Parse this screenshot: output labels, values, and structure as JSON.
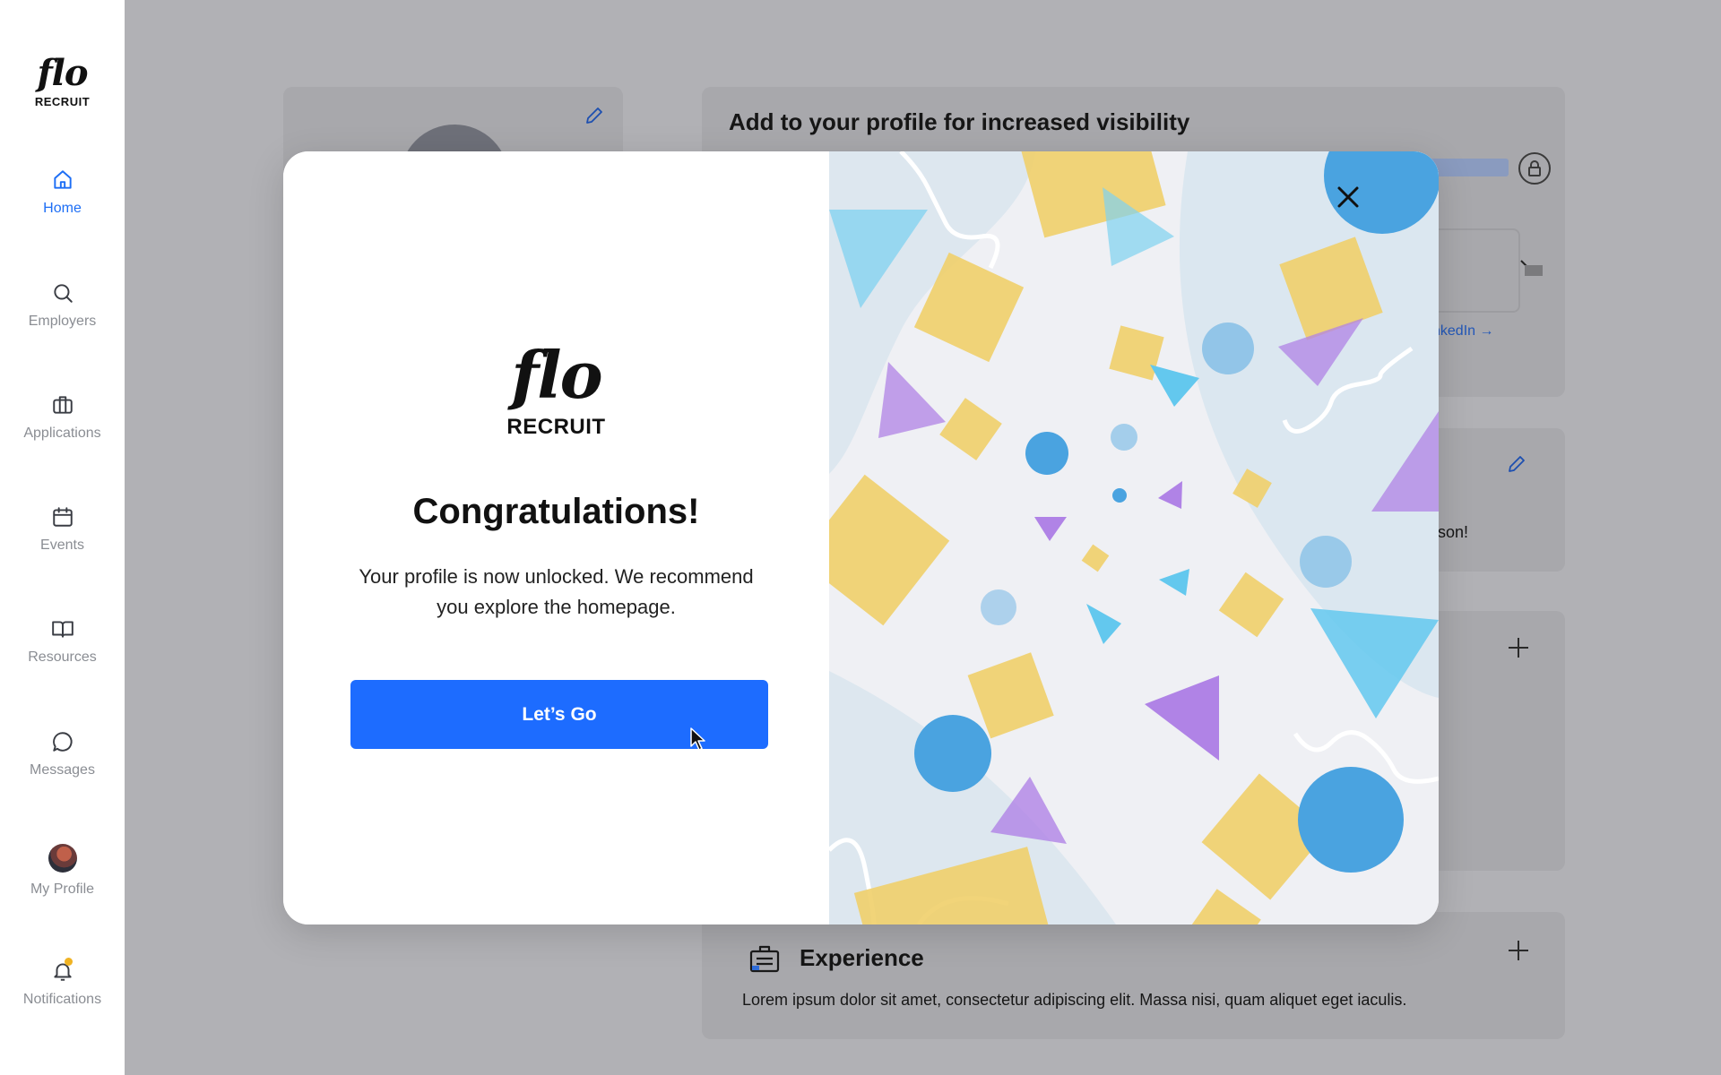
{
  "app": {
    "logo_script": "flo",
    "logo_word": "RECRUIT"
  },
  "sidebar": {
    "items": [
      {
        "label": "Home",
        "icon": "home-icon",
        "active": true
      },
      {
        "label": "Employers",
        "icon": "search-icon"
      },
      {
        "label": "Applications",
        "icon": "briefcase-icon"
      },
      {
        "label": "Events",
        "icon": "calendar-icon"
      },
      {
        "label": "Resources",
        "icon": "book-icon"
      },
      {
        "label": "Messages",
        "icon": "message-icon"
      },
      {
        "label": "My Profile",
        "icon": "avatar"
      },
      {
        "label": "Notifications",
        "icon": "bell-icon"
      }
    ]
  },
  "background": {
    "visibility_title": "Add to your profile for increased visibility",
    "linkedin_link": "nkedIn →",
    "partial_text": "rson!",
    "experience_title": "Experience",
    "experience_text": "Lorem ipsum dolor sit amet, consectetur adipiscing elit. Massa nisi, quam aliquet eget iaculis."
  },
  "modal": {
    "logo_script": "flo",
    "logo_word": "RECRUIT",
    "title": "Congratulations!",
    "message": "Your profile is now unlocked. We recommend you explore the homepage.",
    "cta_label": "Let’s Go"
  },
  "colors": {
    "accent": "#1d6cff",
    "shape_yellow": "#f0cf6a",
    "shape_blue": "#4aa3e0",
    "shape_cyan": "#7fd2f0",
    "shape_purple": "#b083e6"
  }
}
